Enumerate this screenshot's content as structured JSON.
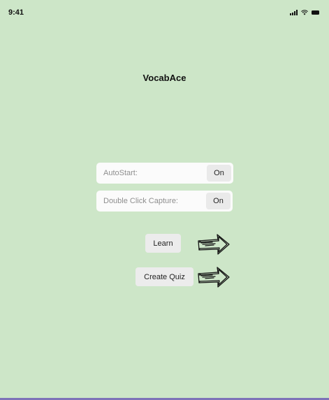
{
  "status_bar": {
    "time": "9:41",
    "icons": [
      "signal-icon",
      "wifi-icon",
      "battery-icon"
    ]
  },
  "app": {
    "title": "VocabAce"
  },
  "settings": [
    {
      "label": "AutoStart:",
      "value": "On"
    },
    {
      "label": "Double Click Capture:",
      "value": "On"
    }
  ],
  "actions": {
    "learn_label": "Learn",
    "create_quiz_label": "Create Quiz",
    "arrow_icon": "hand-drawn-right-arrow-icon"
  },
  "colors": {
    "background": "#cde6c8",
    "row_background": "#fbfbfb",
    "button_background": "#ececec",
    "home_indicator": "#7d73b8"
  }
}
